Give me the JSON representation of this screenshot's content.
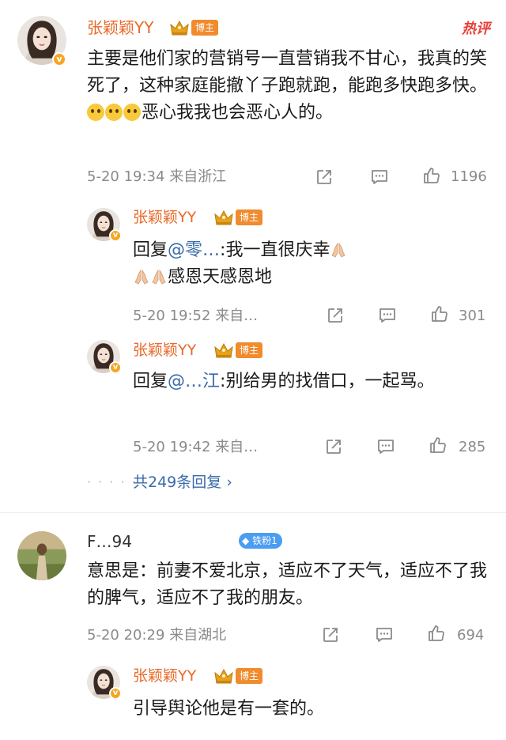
{
  "comments": [
    {
      "username": "张颖颖YY",
      "badge": "博主",
      "hot_label": "热评",
      "text_before": "主要是他们家的营销号一直营销我不甘心，我真的笑死了，这种家庭能撤丫子跑就跑，能跑多快跑多快。",
      "text_after": "恶心我我也会恶心人的。",
      "time": "5-20 19:34",
      "location": "来自浙江",
      "likes": "1196",
      "replies": [
        {
          "username": "张颖颖YY",
          "badge": "博主",
          "reply_prefix": "回复",
          "mention": "@零…",
          "text_a": ":我一直很庆幸",
          "text_b": "感恩天感恩地",
          "time": "5-20 19:52",
          "location": "来自…",
          "likes": "301"
        },
        {
          "username": "张颖颖YY",
          "badge": "博主",
          "reply_prefix": "回复",
          "mention": "@…江",
          "text_a": ":别给男的找借口，一起骂。",
          "time": "5-20 19:42",
          "location": "来自…",
          "likes": "285"
        }
      ],
      "more_replies": "共249条回复 ›"
    },
    {
      "username": "F…94",
      "badge": "铁粉1",
      "text": "意思是：前妻不爱北京，适应不了天气，适应不了我的脾气，适应不了我的朋友。",
      "time": "5-20 20:29",
      "location": "来自湖北",
      "likes": "694",
      "replies": [
        {
          "username": "张颖颖YY",
          "badge": "博主",
          "text": "引导舆论他是有一套的。"
        }
      ]
    }
  ],
  "icons": {
    "share": "share-icon",
    "comment": "comment-icon",
    "like": "thumbs-up-icon",
    "crown": "crown-icon",
    "verified": "verified-v-icon"
  },
  "colors": {
    "username": "#e86a2a",
    "link": "#3a6aa8",
    "meta": "#8a8a8a",
    "badge_blogger": "#f08b2e",
    "badge_fan": "#4b9df2",
    "hot": "#e8403a"
  }
}
